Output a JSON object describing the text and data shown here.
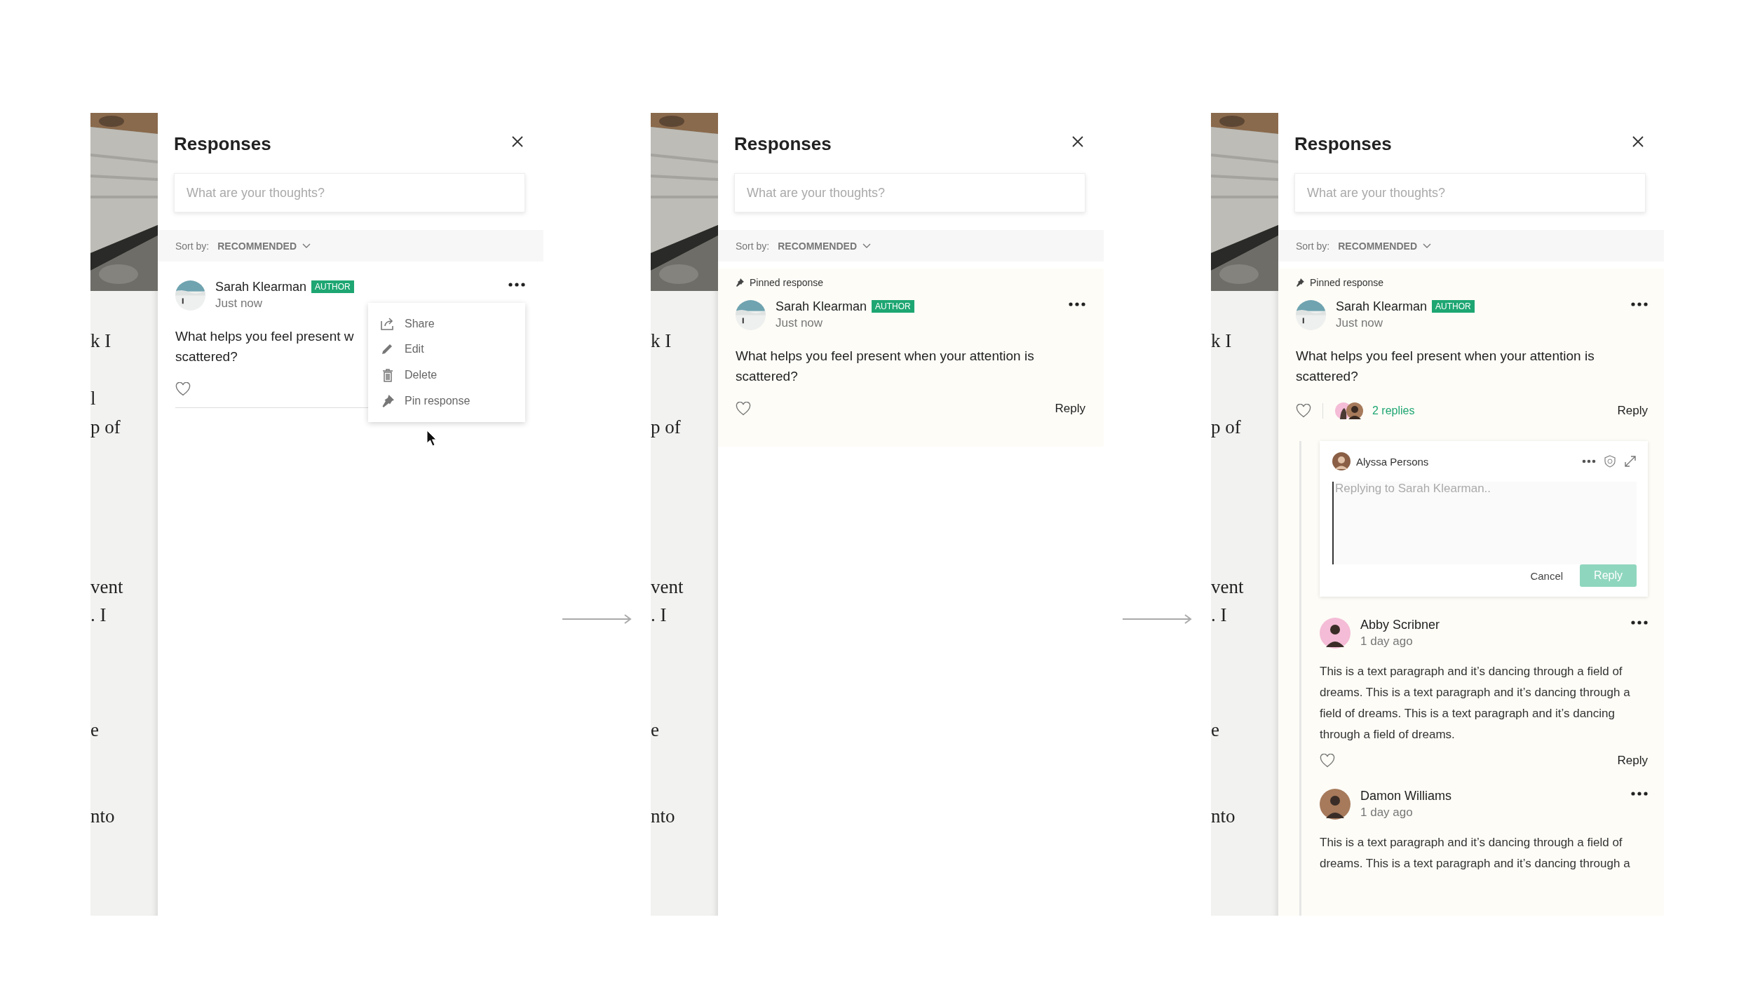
{
  "screens": [
    {
      "article": {
        "lines": [
          "k I",
          "l",
          "p of",
          "vent",
          ". I",
          "e",
          "nto"
        ]
      },
      "panel": {
        "title": "Responses",
        "search": {
          "placeholder": "What are your thoughts?"
        },
        "sort": {
          "label": "Sort by:",
          "value": "RECOMMENDED"
        },
        "response": {
          "pinned": false,
          "author": "Sarah Klearman",
          "badge": "AUTHOR",
          "time": "Just now",
          "body": "What helps you feel present w\nscattered?"
        },
        "menu": {
          "items": [
            {
              "kind": "share",
              "label": "Share"
            },
            {
              "kind": "edit",
              "label": "Edit"
            },
            {
              "kind": "delete",
              "label": "Delete"
            },
            {
              "kind": "pin",
              "label": "Pin response"
            }
          ]
        }
      }
    },
    {
      "article": {
        "lines": [
          "k I",
          "p of",
          "vent",
          ". I",
          "e",
          "nto"
        ]
      },
      "panel": {
        "title": "Responses",
        "search": {
          "placeholder": "What are your thoughts?"
        },
        "sort": {
          "label": "Sort by:",
          "value": "RECOMMENDED"
        },
        "response": {
          "pinned": true,
          "pinned_label": "Pinned response",
          "author": "Sarah Klearman",
          "badge": "AUTHOR",
          "time": "Just now",
          "body": "What helps you feel present when your attention is scattered?",
          "reply_label": "Reply"
        }
      }
    },
    {
      "article": {
        "lines": [
          "k I",
          "p of",
          "vent",
          ". I",
          "e",
          "nto"
        ]
      },
      "panel": {
        "title": "Responses",
        "search": {
          "placeholder": "What are your thoughts?"
        },
        "sort": {
          "label": "Sort by:",
          "value": "RECOMMENDED"
        },
        "response": {
          "pinned": true,
          "pinned_label": "Pinned response",
          "author": "Sarah Klearman",
          "badge": "AUTHOR",
          "time": "Just now",
          "body": "What helps you feel present when your attention is scattered?",
          "replies_summary": "2 replies",
          "reply_label": "Reply"
        },
        "composer": {
          "user": "Alyssa Persons",
          "placeholder": "Replying to Sarah Klearman..",
          "cancel": "Cancel",
          "submit": {
            "label": "Reply",
            "disabled": true
          }
        },
        "replies": [
          {
            "author": "Abby Scribner",
            "color": "#f4bcd6",
            "time": "1 day ago",
            "body": "This is a text paragraph and it’s dancing through a field of dreams. This is a text paragraph and it’s dancing through a field of dreams. This is a text paragraph and it’s dancing through a field of dreams.",
            "reply_label": "Reply"
          },
          {
            "author": "Damon Williams",
            "color": "#a67a5b",
            "time": "1 day ago",
            "body": "This is a text paragraph and it’s dancing through a field of dreams. This is a text paragraph and it’s dancing through a"
          }
        ]
      }
    }
  ]
}
